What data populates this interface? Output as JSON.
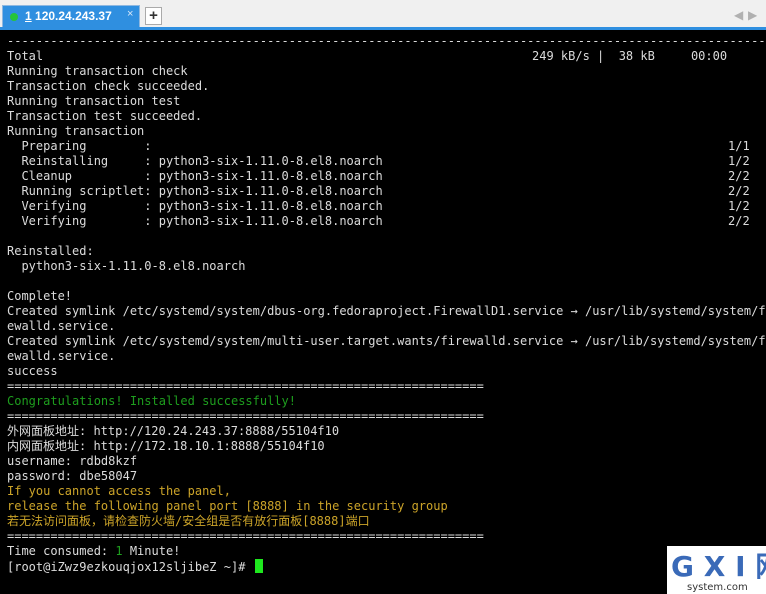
{
  "tab": {
    "number": "1",
    "host": "120.24.243.37",
    "close_glyph": "×",
    "new_glyph": "+"
  },
  "nav": {
    "prev": "◀",
    "next": "▶"
  },
  "terminal": {
    "lines": [
      {
        "text": "-----------------------------------------------------------------------------------------------------------",
        "style": ""
      },
      {
        "text": "Total",
        "style": ""
      },
      {
        "text": "Running transaction check",
        "style": ""
      },
      {
        "text": "Transaction check succeeded.",
        "style": ""
      },
      {
        "text": "Running transaction test",
        "style": ""
      },
      {
        "text": "Transaction test succeeded.",
        "style": ""
      },
      {
        "text": "Running transaction",
        "style": ""
      },
      {
        "text": "  Preparing        :",
        "style": ""
      },
      {
        "text": "  Reinstalling     : python3-six-1.11.0-8.el8.noarch",
        "style": ""
      },
      {
        "text": "  Cleanup          : python3-six-1.11.0-8.el8.noarch",
        "style": ""
      },
      {
        "text": "  Running scriptlet: python3-six-1.11.0-8.el8.noarch",
        "style": ""
      },
      {
        "text": "  Verifying        : python3-six-1.11.0-8.el8.noarch",
        "style": ""
      },
      {
        "text": "  Verifying        : python3-six-1.11.0-8.el8.noarch",
        "style": ""
      },
      {
        "text": "",
        "style": ""
      },
      {
        "text": "Reinstalled:",
        "style": ""
      },
      {
        "text": "  python3-six-1.11.0-8.el8.noarch",
        "style": ""
      },
      {
        "text": "",
        "style": ""
      },
      {
        "text": "Complete!",
        "style": ""
      },
      {
        "text": "Created symlink /etc/systemd/system/dbus-org.fedoraproject.FirewallD1.service → /usr/lib/systemd/system/fir",
        "style": ""
      },
      {
        "text": "ewalld.service.",
        "style": ""
      },
      {
        "text": "Created symlink /etc/systemd/system/multi-user.target.wants/firewalld.service → /usr/lib/systemd/system/fir",
        "style": ""
      },
      {
        "text": "ewalld.service.",
        "style": ""
      },
      {
        "text": "success",
        "style": ""
      },
      {
        "text": "==================================================================",
        "style": ""
      },
      {
        "text": "Congratulations! Installed successfully!",
        "style": "green"
      },
      {
        "text": "==================================================================",
        "style": ""
      },
      {
        "text": "外网面板地址: http://120.24.243.37:8888/55104f10",
        "style": ""
      },
      {
        "text": "内网面板地址: http://172.18.10.1:8888/55104f10",
        "style": ""
      },
      {
        "text": "username: rdbd8kzf",
        "style": ""
      },
      {
        "text": "password: dbe58047",
        "style": ""
      },
      {
        "text": "If you cannot access the panel,",
        "style": "yellow"
      },
      {
        "text": "release the following panel port [8888] in the security group",
        "style": "yellow"
      },
      {
        "text": "若无法访问面板，请检查防火墙/安全组是否有放行面板[8888]端口",
        "style": "yellow"
      },
      {
        "text": "==================================================================",
        "style": ""
      }
    ],
    "total_stats": "249 kB/s |  38 kB     00:00",
    "progress": [
      "1/1",
      "1/2",
      "2/2",
      "2/2",
      "1/2",
      "2/2"
    ],
    "time_consumed": {
      "label": "Time consumed: ",
      "value": "1",
      "unit": " Minute!"
    },
    "prompt": "[root@iZwz9ezkouqjox12sljibeZ ~]# "
  },
  "watermark": {
    "text_big": "G X I 网",
    "text_small": "system.com"
  }
}
